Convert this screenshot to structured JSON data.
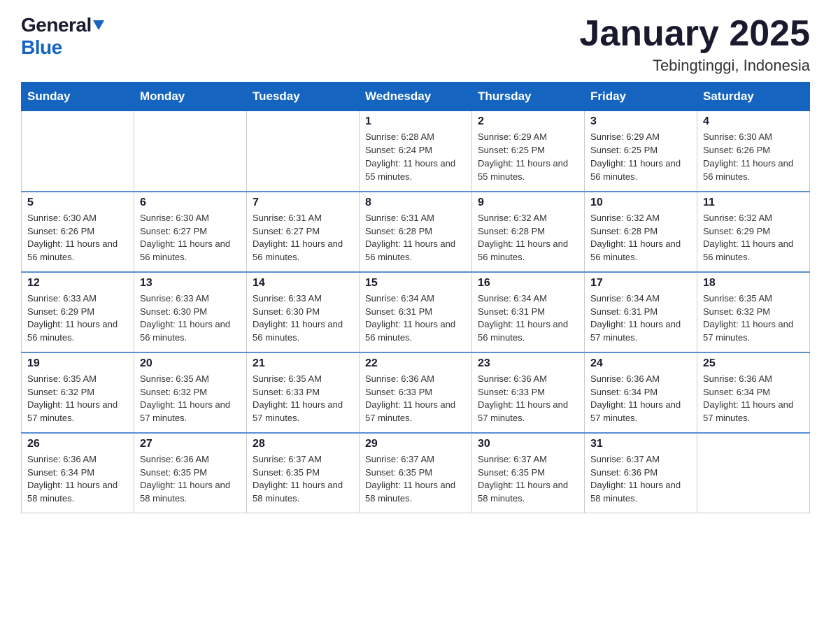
{
  "header": {
    "logo_general": "General",
    "logo_blue": "Blue",
    "month_title": "January 2025",
    "location": "Tebingtinggi, Indonesia"
  },
  "weekdays": [
    "Sunday",
    "Monday",
    "Tuesday",
    "Wednesday",
    "Thursday",
    "Friday",
    "Saturday"
  ],
  "weeks": [
    [
      {
        "day": "",
        "info": ""
      },
      {
        "day": "",
        "info": ""
      },
      {
        "day": "",
        "info": ""
      },
      {
        "day": "1",
        "info": "Sunrise: 6:28 AM\nSunset: 6:24 PM\nDaylight: 11 hours and 55 minutes."
      },
      {
        "day": "2",
        "info": "Sunrise: 6:29 AM\nSunset: 6:25 PM\nDaylight: 11 hours and 55 minutes."
      },
      {
        "day": "3",
        "info": "Sunrise: 6:29 AM\nSunset: 6:25 PM\nDaylight: 11 hours and 56 minutes."
      },
      {
        "day": "4",
        "info": "Sunrise: 6:30 AM\nSunset: 6:26 PM\nDaylight: 11 hours and 56 minutes."
      }
    ],
    [
      {
        "day": "5",
        "info": "Sunrise: 6:30 AM\nSunset: 6:26 PM\nDaylight: 11 hours and 56 minutes."
      },
      {
        "day": "6",
        "info": "Sunrise: 6:30 AM\nSunset: 6:27 PM\nDaylight: 11 hours and 56 minutes."
      },
      {
        "day": "7",
        "info": "Sunrise: 6:31 AM\nSunset: 6:27 PM\nDaylight: 11 hours and 56 minutes."
      },
      {
        "day": "8",
        "info": "Sunrise: 6:31 AM\nSunset: 6:28 PM\nDaylight: 11 hours and 56 minutes."
      },
      {
        "day": "9",
        "info": "Sunrise: 6:32 AM\nSunset: 6:28 PM\nDaylight: 11 hours and 56 minutes."
      },
      {
        "day": "10",
        "info": "Sunrise: 6:32 AM\nSunset: 6:28 PM\nDaylight: 11 hours and 56 minutes."
      },
      {
        "day": "11",
        "info": "Sunrise: 6:32 AM\nSunset: 6:29 PM\nDaylight: 11 hours and 56 minutes."
      }
    ],
    [
      {
        "day": "12",
        "info": "Sunrise: 6:33 AM\nSunset: 6:29 PM\nDaylight: 11 hours and 56 minutes."
      },
      {
        "day": "13",
        "info": "Sunrise: 6:33 AM\nSunset: 6:30 PM\nDaylight: 11 hours and 56 minutes."
      },
      {
        "day": "14",
        "info": "Sunrise: 6:33 AM\nSunset: 6:30 PM\nDaylight: 11 hours and 56 minutes."
      },
      {
        "day": "15",
        "info": "Sunrise: 6:34 AM\nSunset: 6:31 PM\nDaylight: 11 hours and 56 minutes."
      },
      {
        "day": "16",
        "info": "Sunrise: 6:34 AM\nSunset: 6:31 PM\nDaylight: 11 hours and 56 minutes."
      },
      {
        "day": "17",
        "info": "Sunrise: 6:34 AM\nSunset: 6:31 PM\nDaylight: 11 hours and 57 minutes."
      },
      {
        "day": "18",
        "info": "Sunrise: 6:35 AM\nSunset: 6:32 PM\nDaylight: 11 hours and 57 minutes."
      }
    ],
    [
      {
        "day": "19",
        "info": "Sunrise: 6:35 AM\nSunset: 6:32 PM\nDaylight: 11 hours and 57 minutes."
      },
      {
        "day": "20",
        "info": "Sunrise: 6:35 AM\nSunset: 6:32 PM\nDaylight: 11 hours and 57 minutes."
      },
      {
        "day": "21",
        "info": "Sunrise: 6:35 AM\nSunset: 6:33 PM\nDaylight: 11 hours and 57 minutes."
      },
      {
        "day": "22",
        "info": "Sunrise: 6:36 AM\nSunset: 6:33 PM\nDaylight: 11 hours and 57 minutes."
      },
      {
        "day": "23",
        "info": "Sunrise: 6:36 AM\nSunset: 6:33 PM\nDaylight: 11 hours and 57 minutes."
      },
      {
        "day": "24",
        "info": "Sunrise: 6:36 AM\nSunset: 6:34 PM\nDaylight: 11 hours and 57 minutes."
      },
      {
        "day": "25",
        "info": "Sunrise: 6:36 AM\nSunset: 6:34 PM\nDaylight: 11 hours and 57 minutes."
      }
    ],
    [
      {
        "day": "26",
        "info": "Sunrise: 6:36 AM\nSunset: 6:34 PM\nDaylight: 11 hours and 58 minutes."
      },
      {
        "day": "27",
        "info": "Sunrise: 6:36 AM\nSunset: 6:35 PM\nDaylight: 11 hours and 58 minutes."
      },
      {
        "day": "28",
        "info": "Sunrise: 6:37 AM\nSunset: 6:35 PM\nDaylight: 11 hours and 58 minutes."
      },
      {
        "day": "29",
        "info": "Sunrise: 6:37 AM\nSunset: 6:35 PM\nDaylight: 11 hours and 58 minutes."
      },
      {
        "day": "30",
        "info": "Sunrise: 6:37 AM\nSunset: 6:35 PM\nDaylight: 11 hours and 58 minutes."
      },
      {
        "day": "31",
        "info": "Sunrise: 6:37 AM\nSunset: 6:36 PM\nDaylight: 11 hours and 58 minutes."
      },
      {
        "day": "",
        "info": ""
      }
    ]
  ]
}
